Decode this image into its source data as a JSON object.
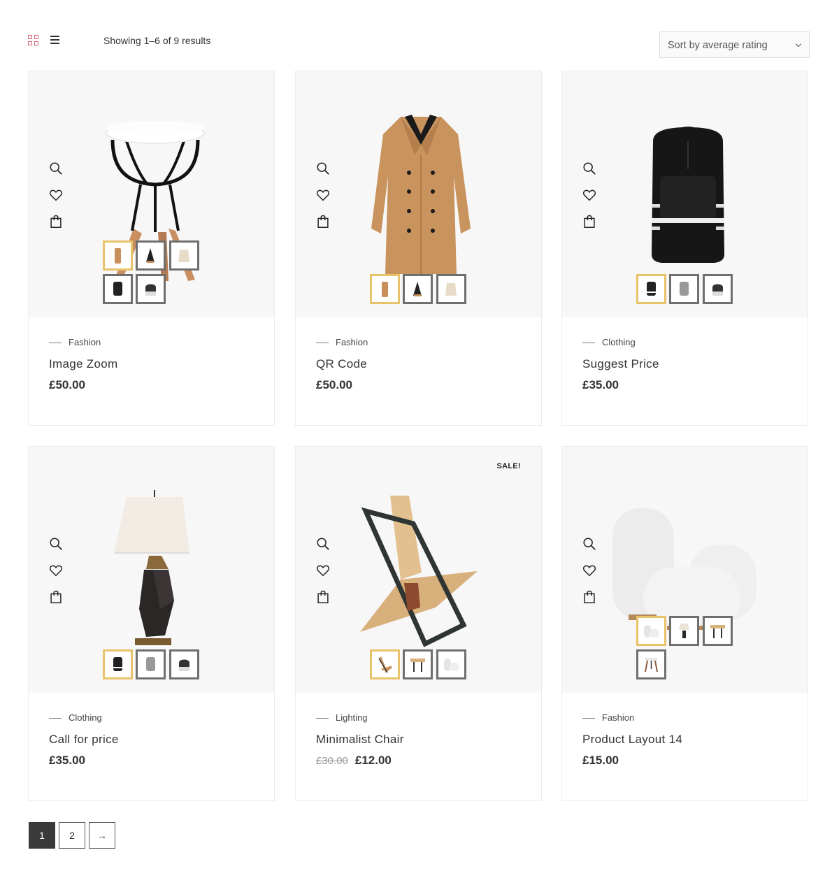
{
  "toolbar": {
    "result_count": "Showing 1–6 of 9 results",
    "sort_label": "Sort by average rating",
    "accent_color": "#e0627a"
  },
  "products": [
    {
      "category": "Fashion",
      "name": "Image Zoom",
      "price": "£50.00",
      "image": "stool"
    },
    {
      "category": "Fashion",
      "name": "QR Code",
      "price": "£50.00",
      "image": "trench-coat"
    },
    {
      "category": "Clothing",
      "name": "Suggest Price",
      "price": "£35.00",
      "image": "backpack"
    },
    {
      "category": "Clothing",
      "name": "Call for price",
      "price": "£35.00",
      "image": "table-lamp"
    },
    {
      "category": "Lighting",
      "name": "Minimalist Chair",
      "old_price": "£30.00",
      "price": "£12.00",
      "sale_badge": "SALE!",
      "image": "wooden-chair"
    },
    {
      "category": "Fashion",
      "name": "Product Layout 14",
      "price": "£15.00",
      "image": "white-poufs"
    }
  ],
  "icons": [
    "grid-view-icon",
    "list-view-icon",
    "search-icon",
    "heart-icon",
    "shopping-bag-icon",
    "chevron-down-icon",
    "arrow-right-icon"
  ],
  "pagination": {
    "pages": [
      "1",
      "2"
    ],
    "next": "→"
  },
  "colors": {
    "active_swatch_border": "#e8c36a",
    "swatch_border": "#6f6f6f",
    "card_media_bg": "#f7f7f7",
    "current_page_bg": "#3a3a3a"
  }
}
